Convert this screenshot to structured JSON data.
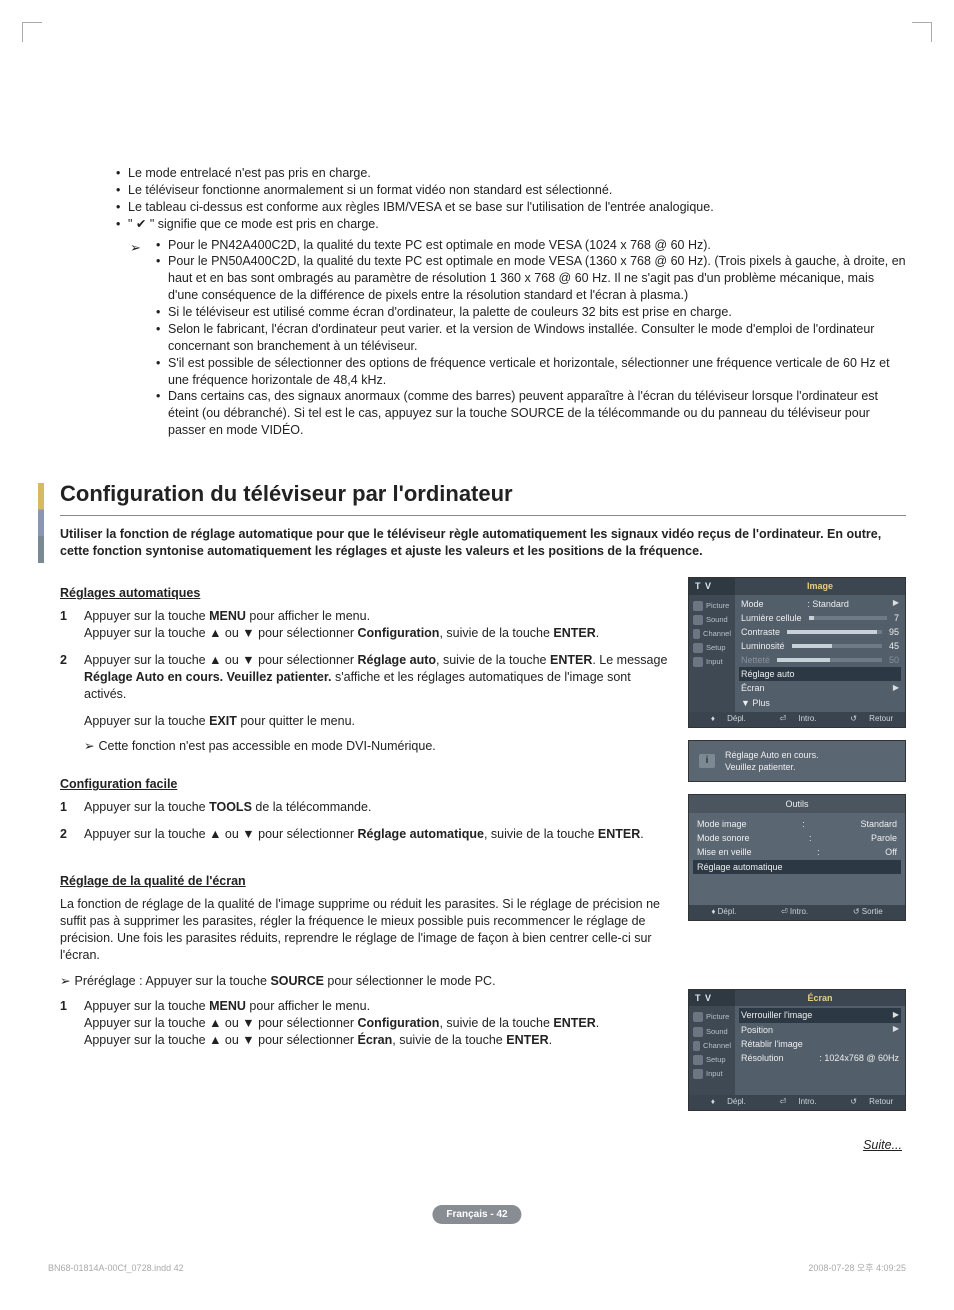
{
  "top_bullets": [
    "Le mode entrelacé n'est pas pris en charge.",
    "Le téléviseur fonctionne anormalement si un format vidéo non standard est sélectionné.",
    "Le tableau ci-dessus est conforme aux règles IBM/VESA et se base sur l'utilisation de l'entrée analogique.",
    "\" ✔ \" signifie que ce mode est pris en charge."
  ],
  "arrow_bullets": [
    "Pour le PN42A400C2D, la qualité du texte PC est optimale en mode VESA (1024 x 768 @ 60 Hz).",
    "Pour le PN50A400C2D, la qualité du texte PC est optimale en mode VESA (1360 x 768 @ 60 Hz). (Trois pixels à gauche, à droite, en haut et en bas sont ombragés au paramètre de résolution 1 360 x 768 @ 60 Hz. Il ne s'agit pas d'un problème mécanique, mais d'une conséquence de la différence de pixels entre la résolution standard et l'écran à plasma.)",
    "Si le téléviseur est utilisé comme écran d'ordinateur, la palette de couleurs 32 bits est prise en charge.",
    "Selon le fabricant, l'écran d'ordinateur peut varier. et la version de Windows installée. Consulter le mode d'emploi de l'ordinateur concernant son branchement à un téléviseur.",
    "S'il est possible de sélectionner des options de fréquence verticale et horizontale, sélectionner une fréquence verticale de 60 Hz et une fréquence horizontale de 48,4 kHz.",
    "Dans certains cas, des signaux anormaux (comme des barres) peuvent apparaître à l'écran du téléviseur lorsque l'ordinateur est éteint (ou débranché). Si tel est le cas, appuyez sur la touche SOURCE de la télécommande ou du panneau du téléviseur pour passer en mode VIDÉO."
  ],
  "section_title": "Configuration du téléviseur par l'ordinateur",
  "section_intro": "Utiliser la fonction de réglage automatique pour que le téléviseur règle automatiquement les signaux vidéo reçus de l'ordinateur. En outre, cette fonction syntonise automatiquement les réglages et ajuste les valeurs et les positions de la fréquence.",
  "sub1": "Réglages automatiques",
  "auto_steps": {
    "s1a": "Appuyer sur la touche ",
    "s1b": " pour afficher le menu.",
    "s1c": "Appuyer sur la touche ▲ ou ▼ pour sélectionner ",
    "s1d": ", suivie de la touche ",
    "s1e": ".",
    "menu": "MENU",
    "config": "Configuration",
    "enter": "ENTER",
    "s2a": "Appuyer sur la touche ▲ ou ▼ pour sélectionner ",
    "reglage_auto": "Réglage auto",
    "s2b": ", suivie de la touche ",
    "s2c": ". Le message ",
    "msg": "Réglage Auto en cours. Veuillez patienter.",
    "s2d": " s'affiche et les réglages automatiques de l'image sont activés.",
    "exit_line_a": "Appuyer sur la touche ",
    "exit": "EXIT",
    "exit_line_b": " pour quitter le menu.",
    "note": "Cette fonction n'est pas accessible en mode DVI-Numérique."
  },
  "sub2": "Configuration facile",
  "easy_steps": {
    "s1a": "Appuyer sur la touche ",
    "tools": "TOOLS",
    "s1b": " de la télécommande.",
    "s2a": "Appuyer sur la touche ▲ ou ▼ pour sélectionner ",
    "ra": "Réglage automatique",
    "s2b": ", suivie de la touche ",
    "enter": "ENTER",
    "s2c": "."
  },
  "sub3": "Réglage de la qualité de l'écran",
  "quality_para": "La fonction de réglage de la qualité de l'image supprime ou réduit les parasites. Si le réglage de précision ne suffit pas à supprimer les parasites, régler la fréquence le mieux possible puis recommencer le réglage de précision. Une fois les parasites réduits, reprendre le réglage de l'image de façon à bien centrer celle-ci sur l'écran.",
  "prereg_a": "Préréglage : Appuyer sur la touche ",
  "source": "SOURCE",
  "prereg_b": " pour sélectionner le mode PC.",
  "q_steps": {
    "s1a": "Appuyer sur la touche ",
    "menu": "MENU",
    "s1b": " pour afficher le menu.",
    "s1c": "Appuyer sur la touche ▲ ou ▼ pour sélectionner ",
    "config": "Configuration",
    "s1d": ", suivie de la touche ",
    "enter": "ENTER",
    "s1e": ".",
    "s1f": "Appuyer sur la touche ▲ ou ▼ pour sélectionner ",
    "ecran": "Écran",
    "s1g": ", suivie de la touche "
  },
  "suite": "Suite...",
  "osd1": {
    "tv": "T V",
    "title": "Image",
    "side": [
      "Picture",
      "Sound",
      "Channel",
      "Setup",
      "Input"
    ],
    "rows": {
      "mode": "Mode",
      "mode_v": ": Standard",
      "lum": "Lumière cellule",
      "lum_v": "7",
      "con": "Contraste",
      "con_v": "95",
      "bri": "Luminosité",
      "bri_v": "45",
      "net": "Netteté",
      "net_v": "50",
      "ra": "Réglage auto",
      "ecr": "Écran",
      "plus": "▼ Plus"
    },
    "foot": {
      "a": "Dépl.",
      "b": "Intro.",
      "c": "Retour"
    }
  },
  "info_msg1": "Réglage Auto en cours.",
  "info_msg2": "Veuillez patienter.",
  "tools_box": {
    "title": "Outils",
    "rows": {
      "mi": "Mode image",
      "mi_v": "Standard",
      "ms": "Mode sonore",
      "ms_v": "Parole",
      "mv": "Mise en veille",
      "mv_v": "Off",
      "ra": "Réglage automatique"
    },
    "foot": {
      "a": "Dépl.",
      "b": "Intro.",
      "c": "Sortie"
    }
  },
  "osd2": {
    "tv": "T V",
    "title": "Écran",
    "side": [
      "Picture",
      "Sound",
      "Channel",
      "Setup",
      "Input"
    ],
    "rows": {
      "ver": "Verrouiller l'image",
      "pos": "Position",
      "ret": "Rétablir l'image",
      "res": "Résolution",
      "res_v": ": 1024x768 @ 60Hz"
    },
    "foot": {
      "a": "Dépl.",
      "b": "Intro.",
      "c": "Retour"
    }
  },
  "page_badge": "Français - 42",
  "footer_left": "BN68-01814A-00Cf_0728.indd   42",
  "footer_right": "2008-07-28   오후 4:09:25"
}
